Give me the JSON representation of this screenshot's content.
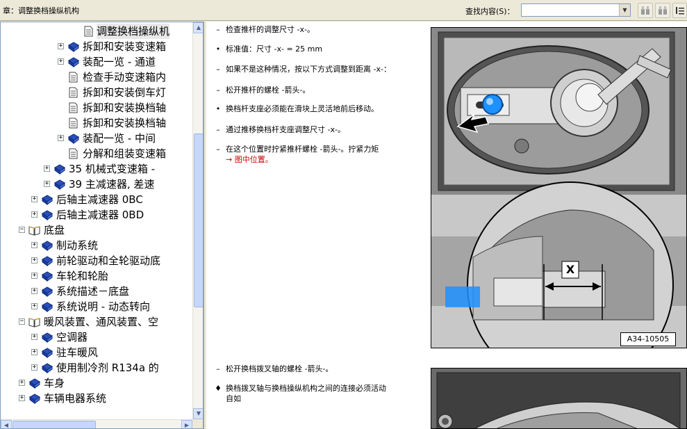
{
  "header": {
    "chapter_title": "章：调整换档操纵机构",
    "search_label": "查找内容(S)：",
    "search_value": "",
    "find_prev_icon": "find-previous-icon",
    "find_next_icon": "find-next-icon",
    "extra_icon": "list-icon"
  },
  "tree": {
    "items": [
      {
        "label": "调整换档操纵机",
        "icon": "page-icon",
        "expander": "",
        "selected": true
      },
      {
        "label": "拆卸和安装变速箱",
        "icon": "book-icon",
        "expander": "+"
      },
      {
        "label": "装配一览 - 通道",
        "icon": "book-icon",
        "expander": "+"
      },
      {
        "label": "检查手动变速箱内",
        "icon": "page-icon",
        "expander": ""
      },
      {
        "label": "拆卸和安装倒车灯",
        "icon": "page-icon",
        "expander": ""
      },
      {
        "label": "拆卸和安装换档轴",
        "icon": "page-icon",
        "expander": ""
      },
      {
        "label": "拆卸和安装换档轴",
        "icon": "page-icon",
        "expander": ""
      },
      {
        "label": "装配一览 - 中间",
        "icon": "book-icon",
        "expander": "+"
      },
      {
        "label": "分解和组装变速箱",
        "icon": "page-icon",
        "expander": ""
      },
      {
        "label": "35 机械式变速箱 -",
        "icon": "book-icon",
        "expander": "+"
      },
      {
        "label": "39 主减速器, 差速",
        "icon": "book-icon",
        "expander": "+"
      },
      {
        "label": "后轴主减速器 0BC",
        "icon": "book-icon",
        "expander": "+"
      },
      {
        "label": "后轴主减速器 0BD",
        "icon": "book-icon",
        "expander": "+"
      },
      {
        "label": "底盘",
        "icon": "open-book-icon",
        "expander": "−"
      },
      {
        "label": "制动系统",
        "icon": "book-icon",
        "expander": "+"
      },
      {
        "label": "前轮驱动和全轮驱动底",
        "icon": "book-icon",
        "expander": "+"
      },
      {
        "label": "车轮和轮胎",
        "icon": "book-icon",
        "expander": "+"
      },
      {
        "label": "系统描述－底盘",
        "icon": "book-icon",
        "expander": "+"
      },
      {
        "label": "系统说明 - 动态转向",
        "icon": "book-icon",
        "expander": "+"
      },
      {
        "label": "暖风装置、通风装置、空",
        "icon": "open-book-icon",
        "expander": "−"
      },
      {
        "label": "空调器",
        "icon": "book-icon",
        "expander": "+"
      },
      {
        "label": "驻车暖风",
        "icon": "book-icon",
        "expander": "+"
      },
      {
        "label": "使用制冷剂 R134a 的",
        "icon": "book-icon",
        "expander": "+"
      },
      {
        "label": "车身",
        "icon": "book-icon",
        "expander": "+"
      },
      {
        "label": "车辆电器系统",
        "icon": "book-icon",
        "expander": "+"
      }
    ]
  },
  "content": {
    "steps": [
      {
        "marker": "–",
        "text": "检查推杆的调整尺寸 -x-。"
      },
      {
        "marker": "•",
        "text": "标准值：尺寸 -x- = 25 mm"
      },
      {
        "marker": "–",
        "text": "如果不是这种情况，按以下方式调整到距离 -x-："
      },
      {
        "marker": "–",
        "text": "松开推杆的螺栓 -箭头-。"
      },
      {
        "marker": "•",
        "text": "换档杆支座必须能在滑块上灵活地前后移动。"
      },
      {
        "marker": "–",
        "text": "通过推移换档杆支座调整尺寸 -x-。"
      },
      {
        "marker": "–",
        "text": "在这个位置时拧紧推杆螺栓 -箭头-。拧紧力矩"
      },
      {
        "marker": "–",
        "text": "松开换档拨叉轴的螺栓 -箭头-。"
      },
      {
        "marker": "♦",
        "text": "换档拨叉轴与换档操纵机构之间的连接必须活动"
      }
    ],
    "link_text": "→ 图中位置。",
    "last_step_continuation": "自如",
    "figure_code": "A34-10505",
    "figure_label_x": "X"
  },
  "colors": {
    "link": "#cc0000",
    "tree_book": "#1c3f9c",
    "highlight_bolt": "#1e90ff"
  }
}
